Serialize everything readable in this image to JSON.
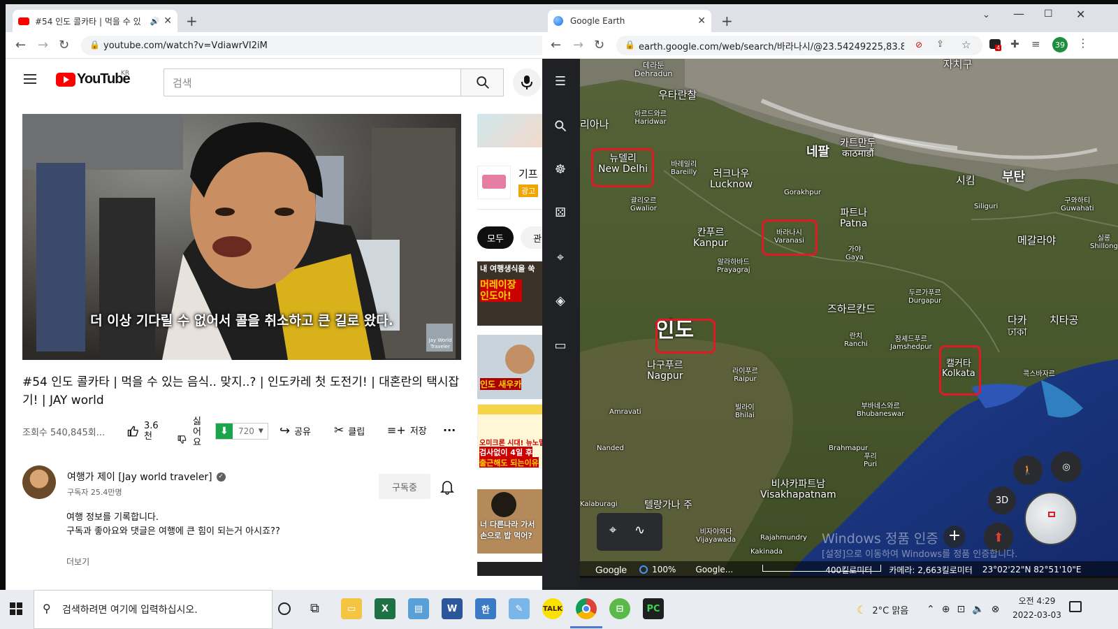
{
  "youtube_window": {
    "tab_title": "#54 인도 콜카타 | 먹을 수 있",
    "url": "youtube.com/watch?v=VdiawrVI2iM",
    "logo_text": "YouTube",
    "region_badge": "KR",
    "search_placeholder": "검색",
    "video_caption": "더 이상 기다릴 수 없어서 콜을 취소하고 큰 길로 왔다.",
    "video_watermark": "Jay World Traveler",
    "video_title": "#54 인도 콜카타 | 먹을 수 있는 음식.. 맞지..? | 인도카레 첫 도전기! | 대혼란의 택시잡기! | JAY world",
    "views": "조회수 540,845회...",
    "like_count_1": "3.6",
    "like_count_2": "천",
    "dislike_label_chars": [
      "싫",
      "어",
      "요"
    ],
    "quality_label": "720",
    "share_label": "공유",
    "clip_label": "클립",
    "save_label": "저장",
    "more_label": "...",
    "channel_name": "여행가 제이 [Jay world traveler]",
    "subscribers": "구독자 25.4만명",
    "subscribe_button": "구독중",
    "description_line1": "여행 정보를 기록합니다.",
    "description_line2": "구독과 좋아요와 댓글은 여행에 큰 힘이 되는거 아시죠??",
    "show_more": "더보기",
    "sidebar_ad_title": "기프",
    "sidebar_ad_badge": "광고",
    "chips": [
      "모두",
      "관련"
    ],
    "thumb_texts": [
      "내 여행생식을 쑥",
      "머레이장 인도아!",
      "인도 새우카",
      "오미크론 시대! 뉴노멀",
      "검사없이 4일 후",
      "출근해도 되는이유",
      "너 다른나라 가서",
      "손으로 밥 먹어?"
    ]
  },
  "earth_window": {
    "tab_title": "Google Earth",
    "url": "earth.google.com/web/search/바라나시/@23.54249225,83.8...",
    "profile_badge": "39",
    "extension_badge": "4",
    "places": {
      "dehradun_ko": "데라둔",
      "dehradun_en": "Dehradun",
      "uttarakhand": "우타란찰",
      "haridwar_ko": "하르드와르",
      "haridwar_en": "Haridwar",
      "haryana": "리아나",
      "newdelhi_ko": "뉴델리",
      "newdelhi_en": "New Delhi",
      "bareilly_ko": "바레일리",
      "bareilly_en": "Bareilly",
      "lucknow_ko": "러크나우",
      "lucknow_en": "Lucknow",
      "gwalior_ko": "괄리오르",
      "gwalior_en": "Gwalior",
      "kanpur_ko": "칸푸르",
      "kanpur_en": "Kanpur",
      "varanasi_ko": "바라나시",
      "varanasi_en": "Varanasi",
      "prayagraj_ko": "알라하바드",
      "prayagraj_en": "Prayagraj",
      "nepal": "네팔",
      "kathmandu_ko": "카트만두",
      "kathmandu_local": "काठमाडौं",
      "gorakhpur": "Gorakhpur",
      "patna_ko": "파트나",
      "patna_en": "Patna",
      "gaya_ko": "가야",
      "gaya_en": "Gaya",
      "sikkim": "시킴",
      "bhutan": "부탄",
      "siliguri": "Siliguri",
      "tibet": "자치구",
      "india": "인도",
      "jharkhand": "즈하르칸드",
      "durgapur_ko": "두르가푸르",
      "durgapur_en": "Durgapur",
      "ranchi_ko": "란치",
      "ranchi_en": "Ranchi",
      "jamshedpur_ko": "잠셰드푸르",
      "jamshedpur_en": "Jamshedpur",
      "kolkata_ko": "캘커타",
      "kolkata_en": "Kolkata",
      "meghalaya": "메갈라야",
      "dhaka_ko": "다카",
      "dhaka_local": "ঢাকা",
      "chittagong": "치타공",
      "guwahati_ko": "구와하티",
      "guwahati_en": "Guwahati",
      "shillong_ko": "실롱",
      "shillong_en": "Shillong",
      "coxsbazar": "콕스바자르",
      "nagpur_ko": "나구푸르",
      "nagpur_en": "Nagpur",
      "raipur_ko": "라이푸르",
      "raipur_en": "Raipur",
      "bhilai_ko": "빌라이",
      "bhilai_en": "Bhilai",
      "amravati": "Amravati",
      "nanded": "Nanded",
      "bhubaneswar_ko": "부바네스와르",
      "bhubaneswar_en": "Bhubaneswar",
      "brahmapur": "Brahmapur",
      "puri_ko": "푸리",
      "puri_en": "Puri",
      "visakhapatnam_ko": "비샤카파트남",
      "visakhapatnam_en": "Visakhapatnam",
      "telangana": "텔랑가나 주",
      "kalaburagi": "Kalaburagi",
      "vijayawada_ko": "비자야와다",
      "vijayawada_en": "Vijayawada",
      "rajahmundry": "Rajahmundry",
      "kakinada": "Kakinada"
    },
    "bottom_bar": {
      "brand": "Google",
      "zoom": "100%",
      "credit": "Google...",
      "scale": "400킬로미터",
      "camera": "카메라: 2,663킬로미터",
      "coords": "23°02'22\"N 82°51'10\"E"
    },
    "button_3d": "3D"
  },
  "watermark": {
    "line1": "Windows 정품 인증",
    "line2": "[설정]으로 이동하여 Windows를 정품 인증합니다."
  },
  "taskbar": {
    "search_placeholder": "검색하려면 여기에 입력하십시오.",
    "weather": "2°C 맑음",
    "time": "오전 4:29",
    "date": "2022-03-03"
  }
}
